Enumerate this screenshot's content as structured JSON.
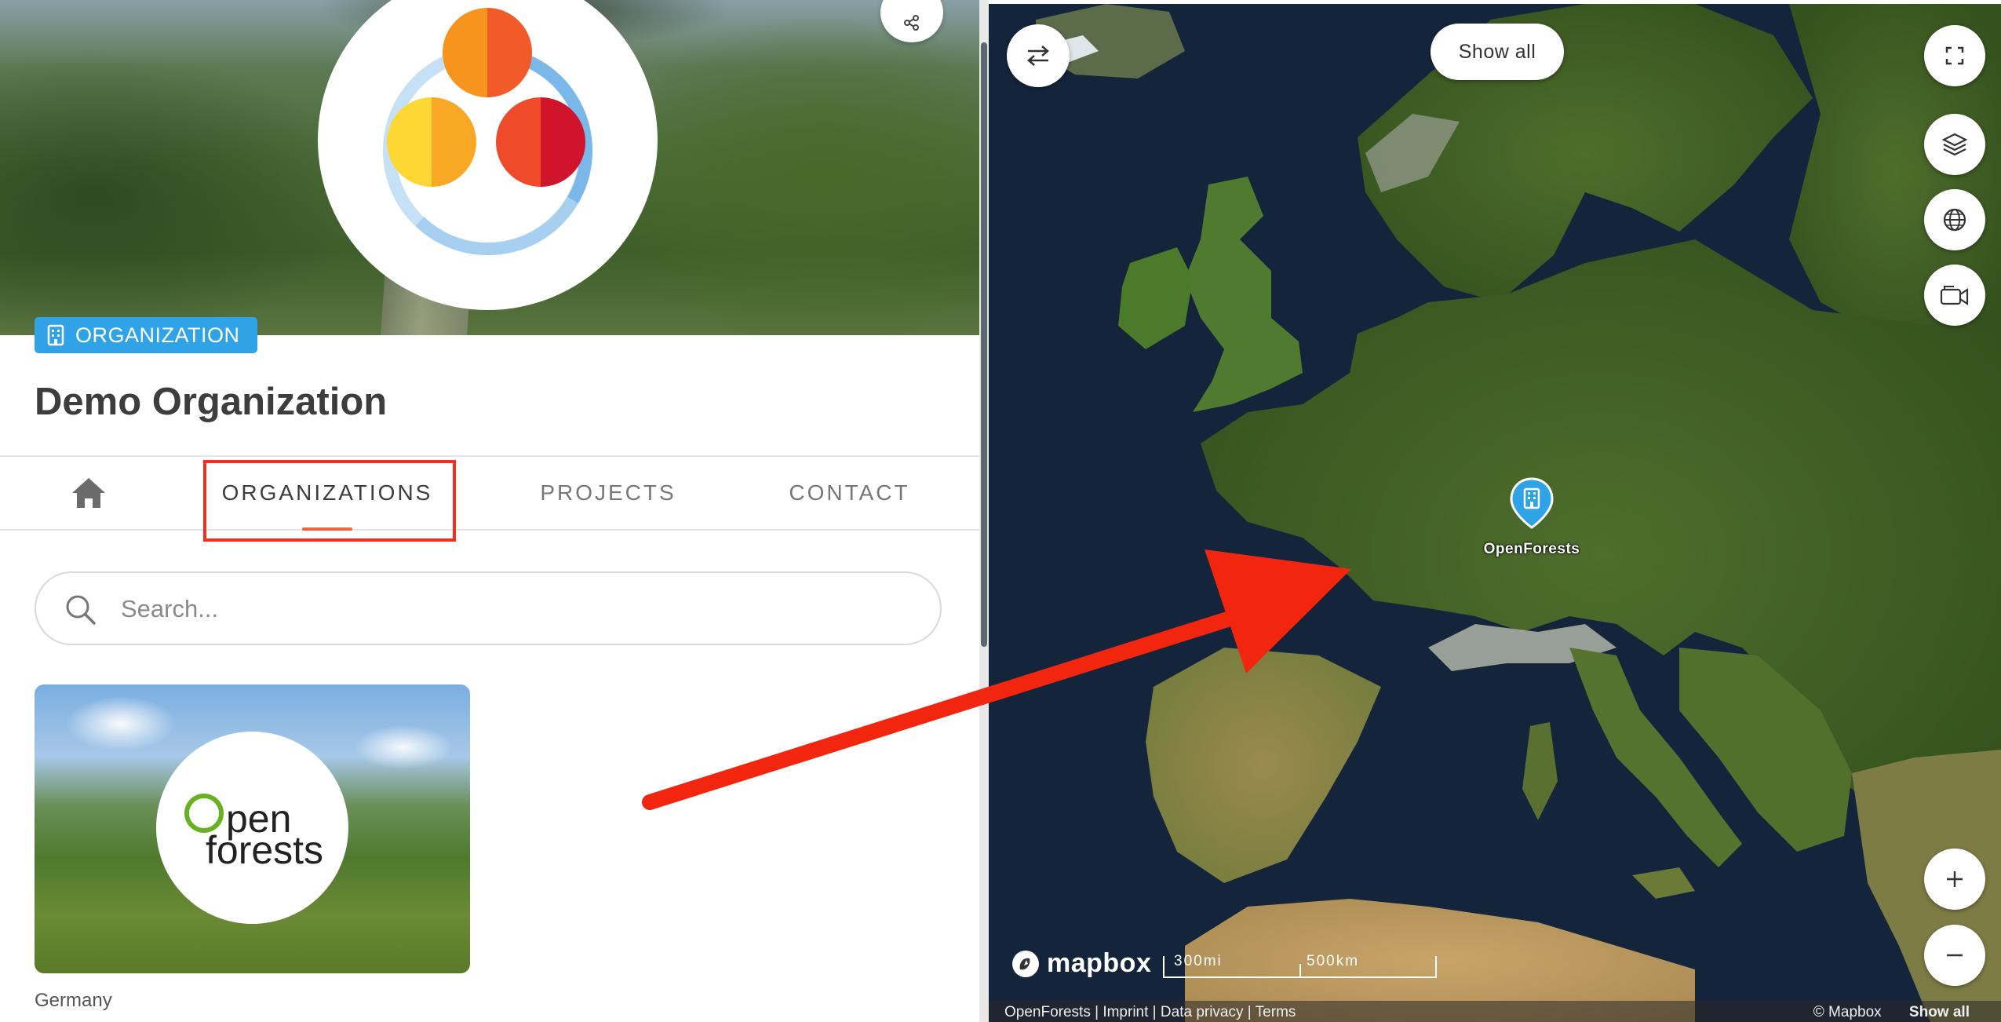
{
  "organization": {
    "badge_label": "ORGANIZATION",
    "name": "Demo Organization"
  },
  "tabs": [
    {
      "label": "home-icon"
    },
    {
      "label": "ORGANIZATIONS"
    },
    {
      "label": "PROJECTS"
    },
    {
      "label": "CONTACT"
    }
  ],
  "search": {
    "placeholder": "Search..."
  },
  "org_card": {
    "logo_text_line1": "pen",
    "logo_text_line2": "forests",
    "country": "Germany"
  },
  "map": {
    "show_all_label": "Show all",
    "marker_label": "OpenForests",
    "provider": "mapbox",
    "scale_miles": "300mi",
    "scale_km": "500km",
    "attribution_links": [
      "OpenForests",
      "Imprint",
      "Data privacy",
      "Terms"
    ],
    "copyright": "© Mapbox",
    "show_all_footer": "Show all"
  },
  "colors": {
    "badge": "#2fa3e6",
    "tab_underline": "#f2643a",
    "annotation": "#ee2f22",
    "marker": "#2fa3e6"
  },
  "icons": [
    "share-icon",
    "building-icon",
    "home-icon",
    "search-icon",
    "swap-icon",
    "fullscreen-icon",
    "layers-icon",
    "globe-icon",
    "camera-icon",
    "plus-icon",
    "minus-icon",
    "map-marker-icon",
    "mapbox-logo-icon"
  ]
}
